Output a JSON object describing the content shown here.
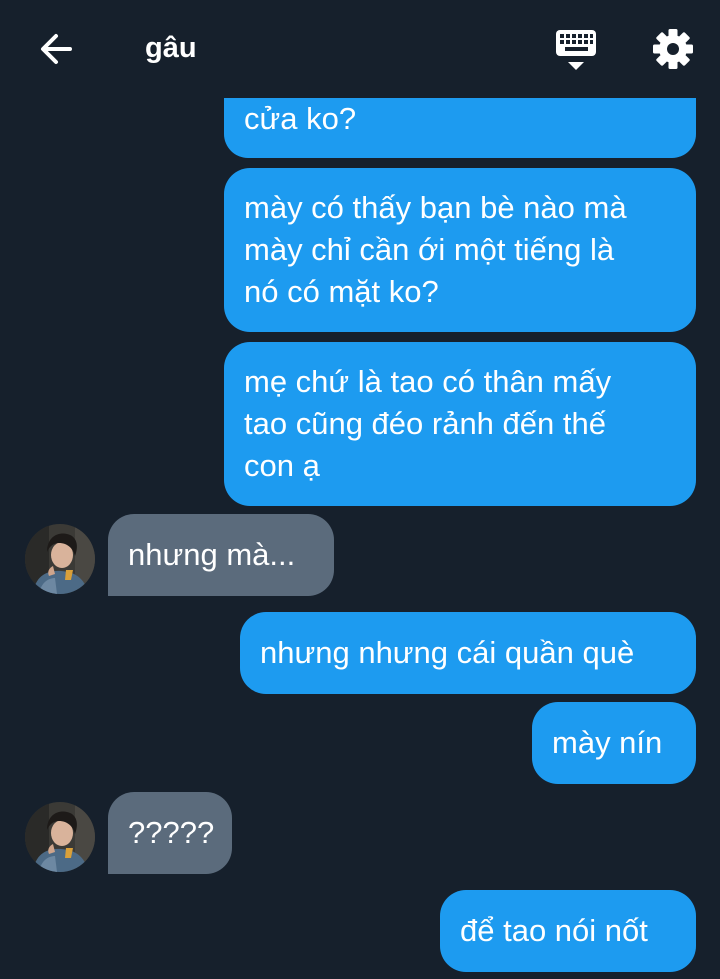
{
  "header": {
    "title": "gâu",
    "back_icon": "arrow-left-icon",
    "keyboard_icon": "keyboard-icon",
    "settings_icon": "gear-icon"
  },
  "colors": {
    "background": "#16202c",
    "outgoing_bubble": "#1d9bf0",
    "incoming_bubble": "#5b6b7c",
    "text": "#ffffff"
  },
  "messages": [
    {
      "direction": "out",
      "lines": [
        "cửa ko?"
      ]
    },
    {
      "direction": "out",
      "lines": [
        "mày có thấy bạn bè nào mà",
        "mày chỉ cần ới một tiếng là",
        "nó có mặt ko?"
      ]
    },
    {
      "direction": "out",
      "lines": [
        "mẹ chứ là tao có thân mấy",
        "tao cũng đéo rảnh đến thế",
        "con ạ"
      ]
    },
    {
      "direction": "in",
      "lines": [
        "nhưng mà..."
      ]
    },
    {
      "direction": "out",
      "lines": [
        "nhưng nhưng cái quần què"
      ]
    },
    {
      "direction": "out",
      "lines": [
        "mày nín"
      ]
    },
    {
      "direction": "in",
      "lines": [
        "?????"
      ]
    },
    {
      "direction": "out",
      "lines": [
        "để tao nói nốt"
      ]
    }
  ]
}
